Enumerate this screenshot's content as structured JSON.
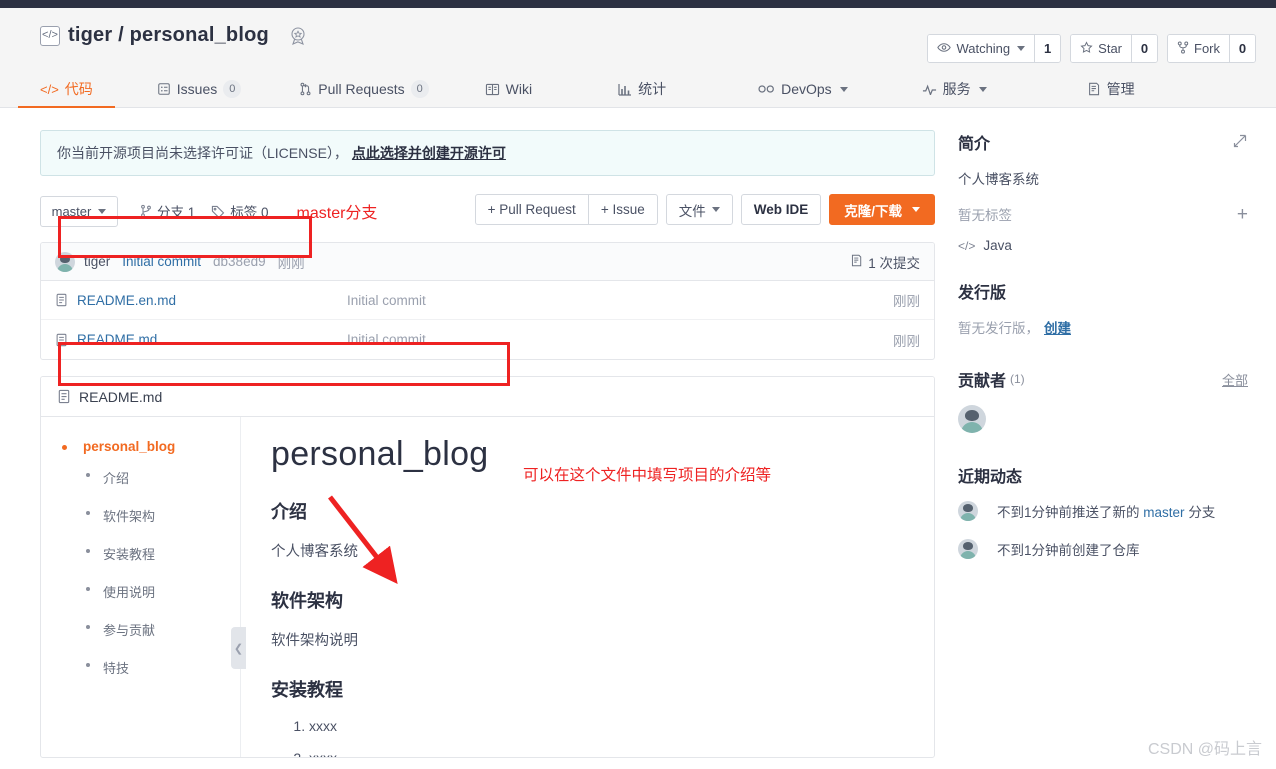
{
  "header": {
    "repo_icon": "code-brackets-icon",
    "owner": "tiger",
    "separator": "/",
    "repo": "personal_blog",
    "badge_icon": "award-badge-icon",
    "actions": [
      {
        "icon": "eye-icon",
        "label": "Watching",
        "count": "1",
        "has_caret": true
      },
      {
        "icon": "star-icon",
        "label": "Star",
        "count": "0",
        "has_caret": false
      },
      {
        "icon": "fork-icon",
        "label": "Fork",
        "count": "0",
        "has_caret": false
      }
    ]
  },
  "nav": {
    "tabs": [
      {
        "icon": "code-icon",
        "label": "代码",
        "count": null,
        "active": true,
        "caret": false
      },
      {
        "icon": "issue-icon",
        "label": "Issues",
        "count": "0",
        "active": false,
        "caret": false
      },
      {
        "icon": "pull-request-icon",
        "label": "Pull Requests",
        "count": "0",
        "active": false,
        "caret": false
      },
      {
        "icon": "wiki-book-icon",
        "label": "Wiki",
        "count": null,
        "active": false,
        "caret": false
      },
      {
        "icon": "chart-bar-icon",
        "label": "统计",
        "count": null,
        "active": false,
        "caret": false
      },
      {
        "icon": "infinity-icon",
        "label": "DevOps",
        "count": null,
        "active": false,
        "caret": true
      },
      {
        "icon": "pulse-icon",
        "label": "服务",
        "count": null,
        "active": false,
        "caret": true
      },
      {
        "icon": "manage-icon",
        "label": "管理",
        "count": null,
        "active": false,
        "caret": false
      }
    ]
  },
  "license_notice": {
    "text": "你当前开源项目尚未选择许可证（LICENSE），",
    "link": "点此选择并创建开源许可"
  },
  "toolbar": {
    "branch": "master",
    "branch_count_icon": "branch-icon",
    "branch_count_label": "分支 1",
    "tag_icon": "tag-icon",
    "tag_count_label": "标签 0",
    "buttons": [
      {
        "label": "+ Pull Request",
        "style": "plain"
      },
      {
        "label": "+ Issue",
        "style": "plain"
      },
      {
        "label": "文件",
        "style": "caret"
      },
      {
        "label": "Web IDE",
        "style": "bold"
      },
      {
        "label": "克隆/下载",
        "style": "primary"
      }
    ]
  },
  "commit_row": {
    "author": "tiger",
    "message": "Initial commit",
    "sha": "db38ed9",
    "time": "刚刚",
    "count_icon": "commit-list-icon",
    "count_label": "1 次提交"
  },
  "files": [
    {
      "icon": "file-icon",
      "name": "README.en.md",
      "message": "Initial commit",
      "time": "刚刚"
    },
    {
      "icon": "file-icon",
      "name": "README.md",
      "message": "Initial commit",
      "time": "刚刚"
    }
  ],
  "readme": {
    "file_icon": "file-icon",
    "filename": "README.md",
    "collapse_icon": "chevron-left-icon",
    "toc": {
      "root": "personal_blog",
      "items": [
        "介绍",
        "软件架构",
        "安装教程",
        "使用说明",
        "参与贡献",
        "特技"
      ]
    },
    "content": {
      "title": "personal_blog",
      "sections": [
        {
          "heading": "介绍",
          "text": "个人博客系统"
        },
        {
          "heading": "软件架构",
          "text": "软件架构说明"
        }
      ],
      "install_heading": "安装教程",
      "install_steps": [
        "xxxx",
        "xxxx"
      ]
    }
  },
  "sidebar": {
    "intro": {
      "title": "简介",
      "edit_icon": "edit-pencil-icon",
      "description": "个人博客系统",
      "no_tags": "暂无标签",
      "add_tag_icon": "plus-icon",
      "lang_icon": "code-icon",
      "language": "Java"
    },
    "releases": {
      "title": "发行版",
      "empty": "暂无发行版，",
      "create_link": "创建"
    },
    "contributors": {
      "title": "贡献者",
      "count": "(1)",
      "all_link": "全部",
      "avatars": [
        "tiger"
      ]
    },
    "activity": {
      "title": "近期动态",
      "items": [
        {
          "prefix": "不到1分钟前推送了新的",
          "highlight": "master",
          "suffix": "分支"
        },
        {
          "prefix": "不到1分钟前创建了仓库",
          "highlight": "",
          "suffix": ""
        }
      ]
    }
  },
  "annotations": {
    "branch_note": "master分支",
    "readme_note": "可以在这个文件中填写项目的介绍等",
    "color": "#ee2222"
  },
  "watermark": "CSDN @码上言"
}
